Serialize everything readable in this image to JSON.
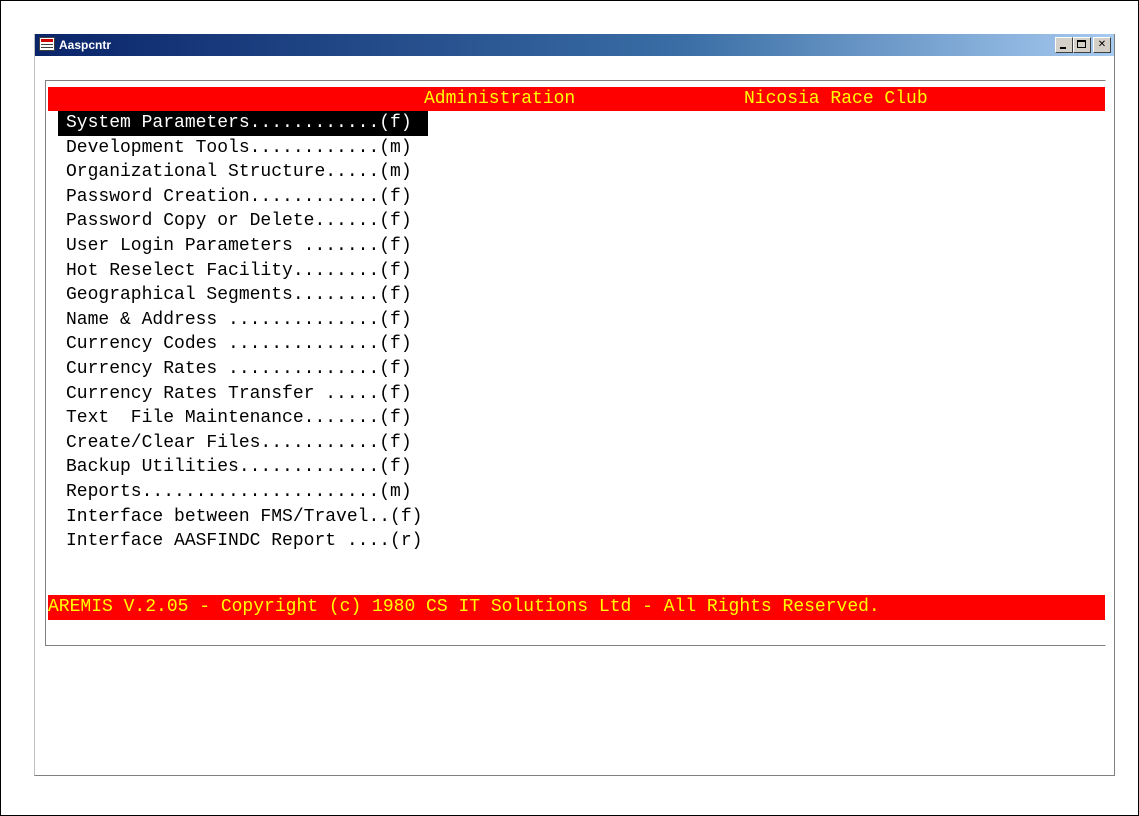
{
  "window": {
    "title": "Aaspcntr",
    "buttons": [
      "minimize",
      "maximize",
      "close"
    ]
  },
  "header": {
    "title": "Administration",
    "club": "Nicosia Race Club"
  },
  "menu": {
    "selected_index": 0,
    "items": [
      {
        "label": "System Parameters............(f)"
      },
      {
        "label": "Development Tools............(m)"
      },
      {
        "label": "Organizational Structure.....(m)"
      },
      {
        "label": "Password Creation............(f)"
      },
      {
        "label": "Password Copy or Delete......(f)"
      },
      {
        "label": "User Login Parameters .......(f)"
      },
      {
        "label": "Hot Reselect Facility........(f)"
      },
      {
        "label": "Geographical Segments........(f)"
      },
      {
        "label": "Name & Address ..............(f)"
      },
      {
        "label": "Currency Codes ..............(f)"
      },
      {
        "label": "Currency Rates ..............(f)"
      },
      {
        "label": "Currency Rates Transfer .....(f)"
      },
      {
        "label": "Text  File Maintenance.......(f)"
      },
      {
        "label": "Create/Clear Files...........(f)"
      },
      {
        "label": "Backup Utilities.............(f)"
      },
      {
        "label": "Reports......................(m)"
      },
      {
        "label": "Interface between FMS/Travel..(f)"
      },
      {
        "label": "Interface AASFINDC Report ....(r)"
      }
    ]
  },
  "footer": {
    "text": "AREMIS V.2.05 - Copyright (c) 1980 CS IT Solutions Ltd - All Rights Reserved."
  },
  "colors": {
    "bar_background": "#ff0000",
    "bar_text": "#ffff00",
    "selection_background": "#000000",
    "selection_text": "#ffffff"
  }
}
